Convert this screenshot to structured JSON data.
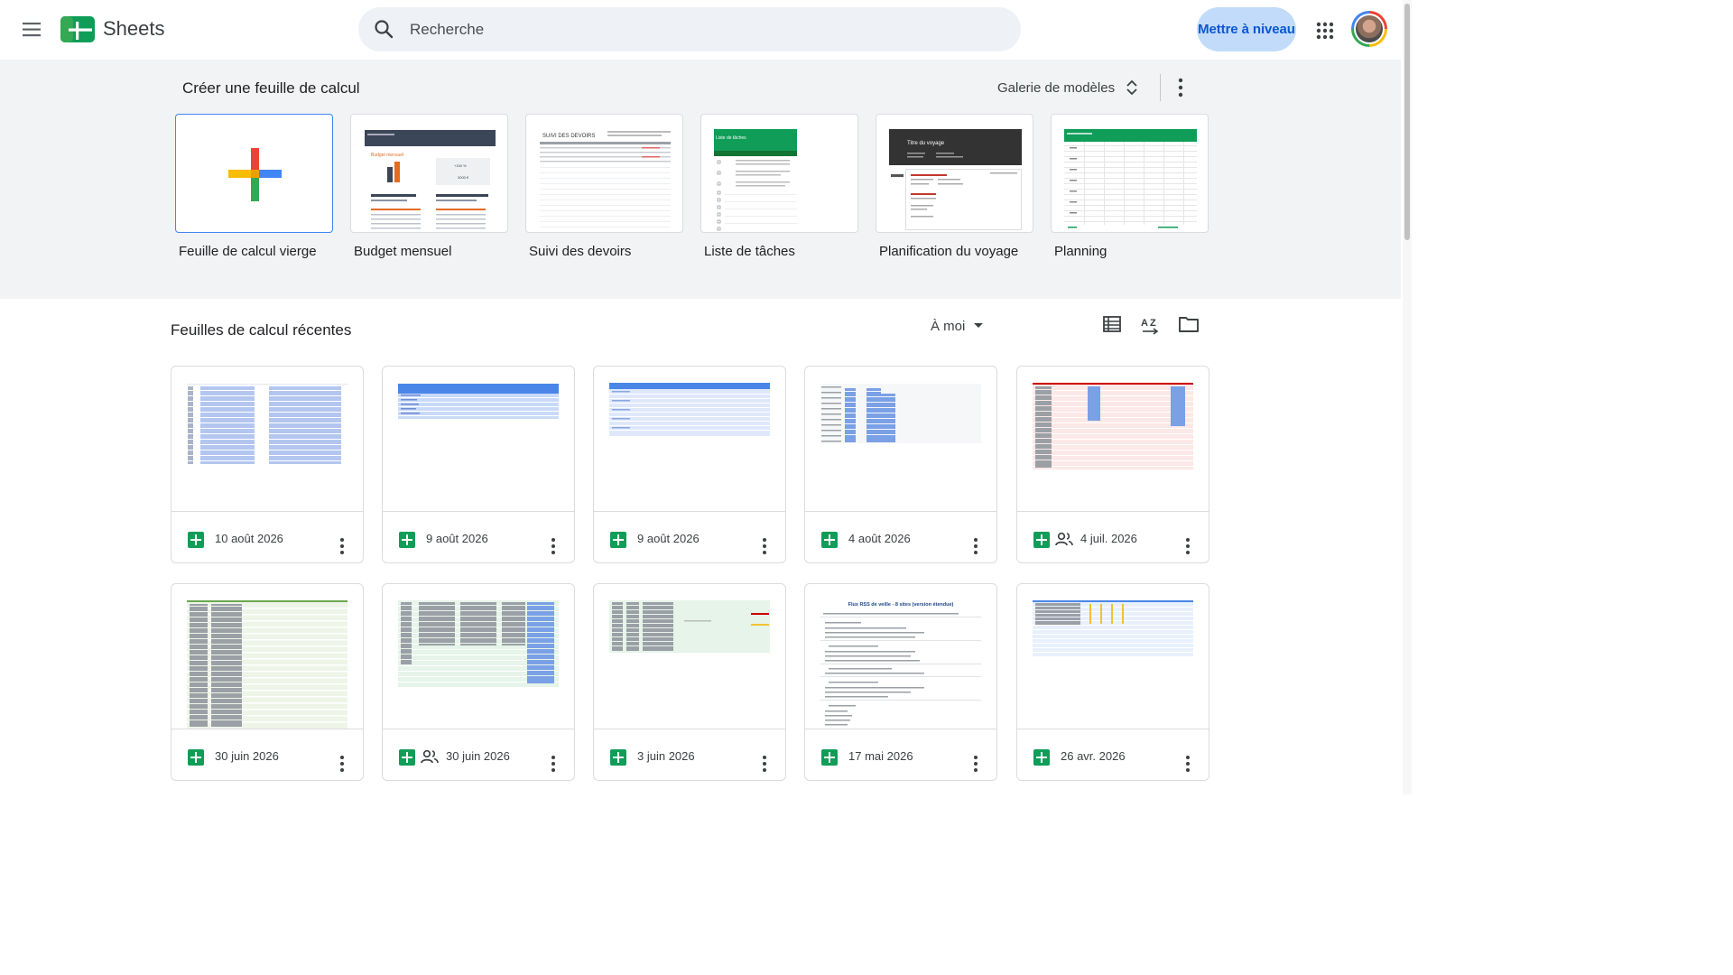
{
  "header": {
    "app_name": "Sheets",
    "search_placeholder": "Recherche",
    "upgrade_label": "Mettre à niveau"
  },
  "templates": {
    "title": "Créer une feuille de calcul",
    "gallery_label": "Galerie de modèles",
    "items": [
      {
        "label": "Feuille de calcul vierge"
      },
      {
        "label": "Budget mensuel",
        "title": "Budget mensuel"
      },
      {
        "label": "Suivi des devoirs",
        "title": "SUIVI DES DEVOIRS"
      },
      {
        "label": "Liste de tâches",
        "title": "Liste de tâches"
      },
      {
        "label": "Planification du voyage",
        "title": "Titre du voyage"
      },
      {
        "label": "Planning"
      }
    ]
  },
  "recent": {
    "title": "Feuilles de calcul récentes",
    "owner_filter": "À moi",
    "files": [
      {
        "date": "10 août 2026",
        "shared": false
      },
      {
        "date": "9 août 2026",
        "shared": false
      },
      {
        "date": "9 août 2026",
        "shared": false
      },
      {
        "date": "4 août 2026",
        "shared": false
      },
      {
        "date": "4 juil. 2026",
        "shared": true
      },
      {
        "date": "30 juin 2026",
        "shared": false
      },
      {
        "date": "30 juin 2026",
        "shared": true
      },
      {
        "date": "3 juin 2026",
        "shared": false
      },
      {
        "date": "17 mai 2026",
        "shared": false,
        "title": "Flux RSS de veille - 8 sites (version étendue)"
      },
      {
        "date": "26 avr. 2026",
        "shared": false
      }
    ]
  },
  "colors": {
    "sheets_green": "#0f9d58",
    "accent_blue": "#0b57d0",
    "upgrade_bg": "#c2dbfb",
    "band_bg": "#f1f3f4"
  },
  "icons": [
    "menu-icon",
    "sheets-logo-icon",
    "search-icon",
    "apps-grid-icon",
    "avatar",
    "plus-icon",
    "unfold-icon",
    "more-vert-icon",
    "dropdown-arrow-icon",
    "list-view-icon",
    "sort-az-icon",
    "folder-icon",
    "sheet-file-icon",
    "shared-people-icon"
  ]
}
